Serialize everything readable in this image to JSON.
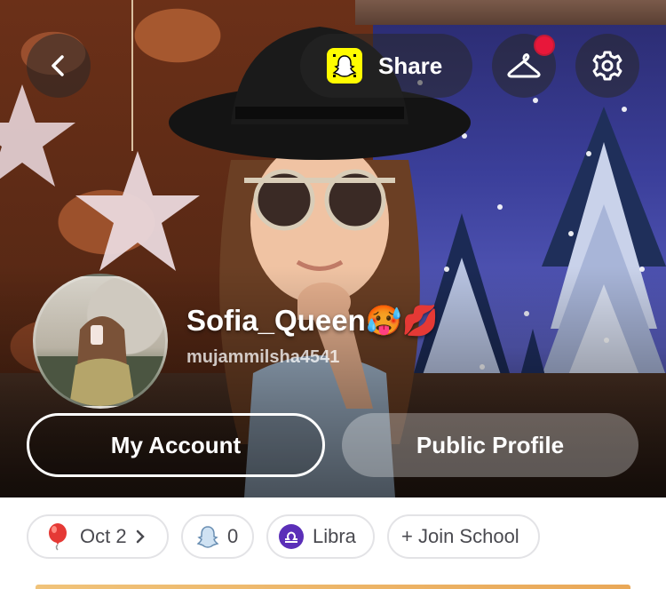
{
  "header": {
    "back_icon": "chevron-left-icon",
    "share_label": "Share",
    "snapcode_icon": "snapcode-icon",
    "wardrobe_icon": "hanger-icon",
    "settings_icon": "gear-icon",
    "notification_color": "#e8173a"
  },
  "profile": {
    "display_name": "Sofia_Queen🥵💋",
    "username": "mujammilsha4541"
  },
  "actions": {
    "my_account": "My Account",
    "public_profile": "Public Profile"
  },
  "chips": {
    "birthday": "Oct 2",
    "birthday_icon": "balloon-icon",
    "friends_count": "0",
    "friends_icon": "ghost-icon",
    "zodiac": "Libra",
    "zodiac_icon": "libra-icon",
    "join_school": "+ Join School"
  },
  "colors": {
    "snapchat_yellow": "#fffc00",
    "zodiac_purple": "#5b2fb8",
    "balloon_red": "#e53935"
  }
}
